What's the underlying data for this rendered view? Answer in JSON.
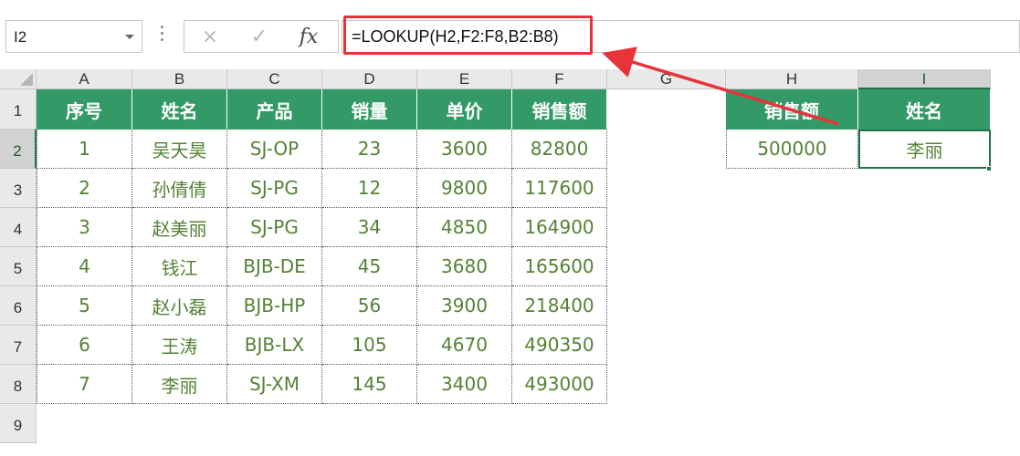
{
  "formula_bar": {
    "name_box": "I2",
    "cancel_icon": "×",
    "enter_icon": "✓",
    "fx_label": "fx",
    "formula": "=LOOKUP(H2,F2:F8,B2:B8)"
  },
  "columns": [
    "A",
    "B",
    "C",
    "D",
    "E",
    "F",
    "G",
    "H",
    "I"
  ],
  "rows": [
    "1",
    "2",
    "3",
    "4",
    "5",
    "6",
    "7",
    "8",
    "9"
  ],
  "table": {
    "headers": [
      "序号",
      "姓名",
      "产品",
      "销量",
      "单价",
      "销售额"
    ],
    "rows": [
      [
        "1",
        "吴天昊",
        "SJ-OP",
        "23",
        "3600",
        "82800"
      ],
      [
        "2",
        "孙倩倩",
        "SJ-PG",
        "12",
        "9800",
        "117600"
      ],
      [
        "3",
        "赵美丽",
        "SJ-PG",
        "34",
        "4850",
        "164900"
      ],
      [
        "4",
        "钱江",
        "BJB-DE",
        "45",
        "3680",
        "165600"
      ],
      [
        "5",
        "赵小磊",
        "BJB-HP",
        "56",
        "3900",
        "218400"
      ],
      [
        "6",
        "王涛",
        "BJB-LX",
        "105",
        "4670",
        "490350"
      ],
      [
        "7",
        "李丽",
        "SJ-XM",
        "145",
        "3400",
        "493000"
      ]
    ]
  },
  "lookup": {
    "headers": [
      "销售额",
      "姓名"
    ],
    "values": [
      "500000",
      "李丽"
    ]
  },
  "colors": {
    "header_green": "#339966",
    "data_text": "#548235",
    "highlight_red": "#E8333A",
    "selection_green": "#217346"
  }
}
